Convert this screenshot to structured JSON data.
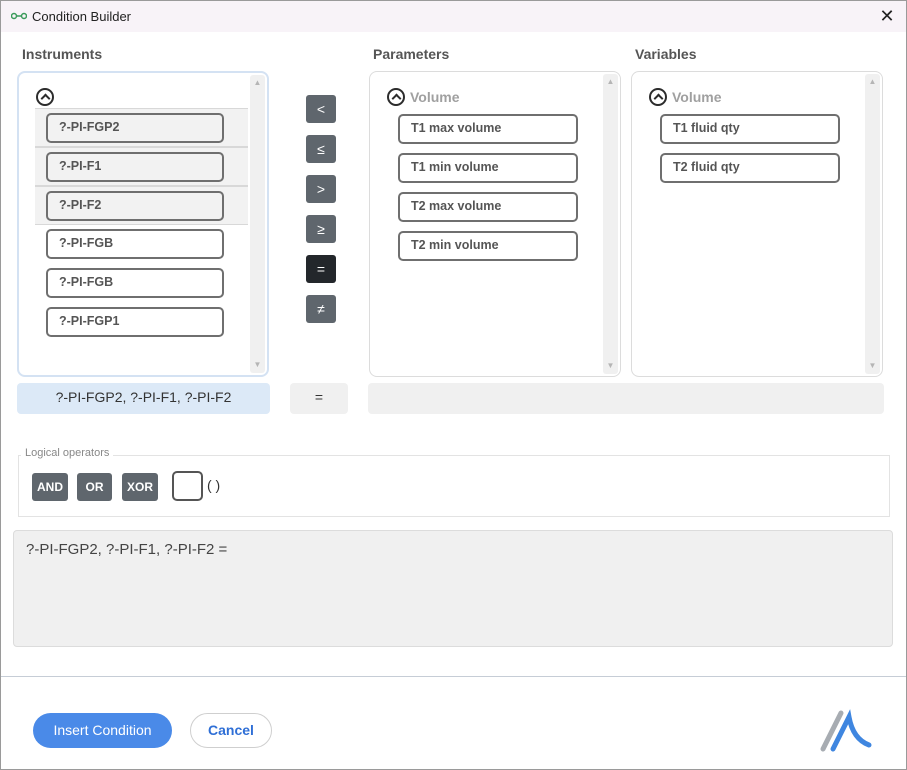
{
  "window": {
    "title": "Condition Builder",
    "close_glyph": "✕",
    "icon": "link-nodes-icon"
  },
  "columns": {
    "instruments": {
      "header": "Instruments"
    },
    "parameters": {
      "header": "Parameters",
      "group": "Volume",
      "items": [
        "T1 max volume",
        "T1 min volume",
        "T2 max volume",
        "T2 min volume"
      ]
    },
    "variables": {
      "header": "Variables",
      "group": "Volume",
      "items": [
        "T1 fluid qty",
        "T2 fluid qty"
      ]
    }
  },
  "instruments": {
    "items": [
      {
        "label": "?-PI-FGP2",
        "selected": true
      },
      {
        "label": "?-PI-F1",
        "selected": true
      },
      {
        "label": "?-PI-F2",
        "selected": true
      },
      {
        "label": "?-PI-FGB",
        "selected": false
      },
      {
        "label": "?-PI-FGB",
        "selected": false
      },
      {
        "label": "?-PI-FGP1",
        "selected": false
      }
    ]
  },
  "operators": {
    "items": [
      "<",
      "≤",
      ">",
      "≥",
      "=",
      "≠"
    ],
    "active": "="
  },
  "summary": {
    "instruments": "?-PI-FGP2, ?-PI-F1, ?-PI-F2",
    "operator": "=",
    "right": ""
  },
  "logical": {
    "legend": "Logical operators",
    "buttons": [
      "AND",
      "OR",
      "XOR"
    ],
    "paren_label": "( )"
  },
  "expression": {
    "text": "?-PI-FGP2, ?-PI-F1, ?-PI-F2 ="
  },
  "footer": {
    "insert_label": "Insert Condition",
    "cancel_label": "Cancel"
  },
  "colors": {
    "primary": "#4a8ae8",
    "operator_bg": "#5f666d",
    "operator_active": "#23272b",
    "selection": "#dce9f7"
  }
}
